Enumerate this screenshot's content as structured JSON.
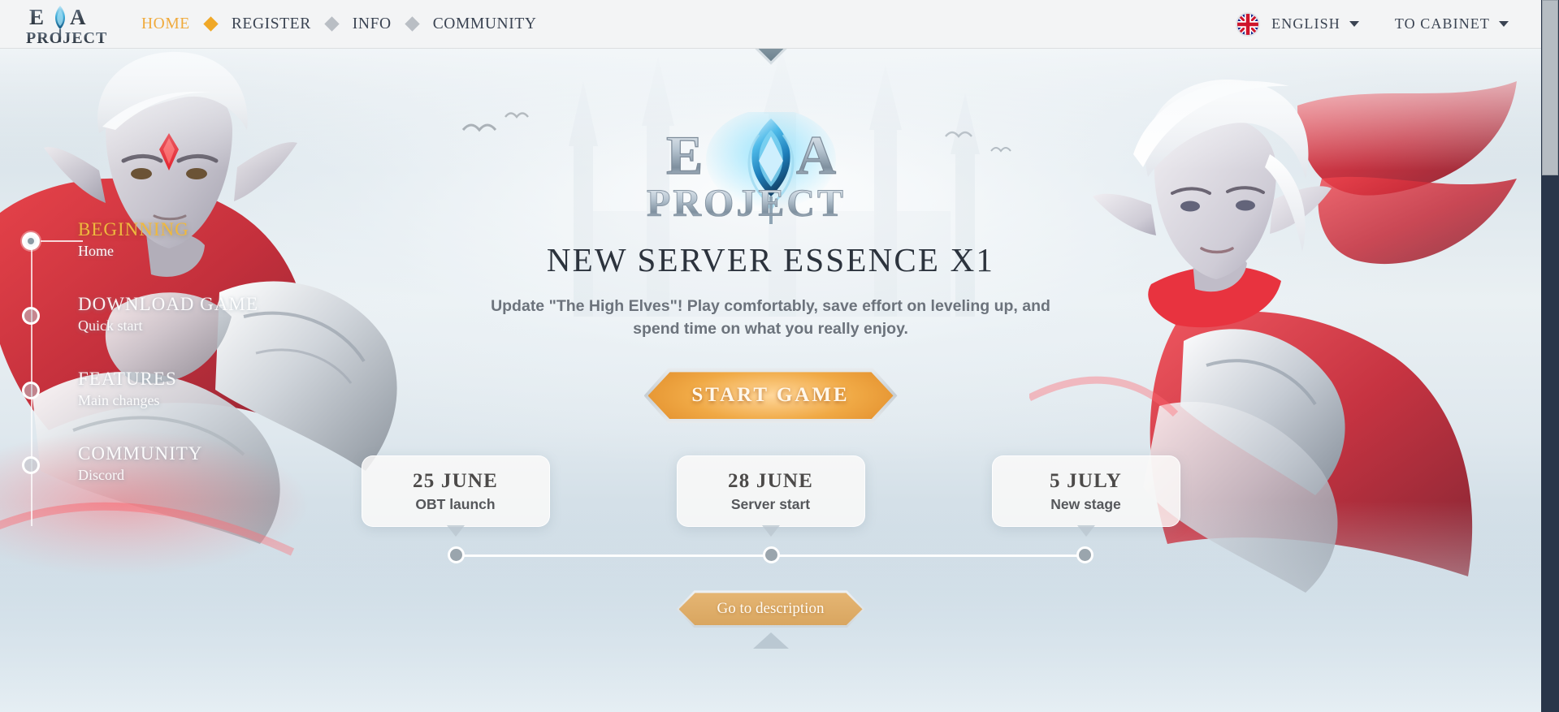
{
  "header": {
    "logo_text_top": "EVA",
    "logo_text_bottom": "PROJECT",
    "logo_icon": "eva-crystal-logo",
    "nav": [
      {
        "label": "HOME",
        "active": true
      },
      {
        "label": "REGISTER",
        "active": false
      },
      {
        "label": "INFO",
        "active": false
      },
      {
        "label": "COMMUNITY",
        "active": false
      }
    ],
    "language": {
      "flag_icon": "uk-flag-icon",
      "label": "ENGLISH",
      "chevron_icon": "chevron-down-icon"
    },
    "cabinet": {
      "label": "TO CABINET",
      "chevron_icon": "chevron-down-icon"
    }
  },
  "sidebar": {
    "items": [
      {
        "title": "BEGINNING",
        "sub": "Home",
        "active": true
      },
      {
        "title": "DOWNLOAD GAME",
        "sub": "Quick start",
        "active": false
      },
      {
        "title": "FEATURES",
        "sub": "Main changes",
        "active": false
      },
      {
        "title": "COMMUNITY",
        "sub": "Discord",
        "active": false
      }
    ]
  },
  "hero": {
    "logo_title_top": "EVA",
    "logo_title_bottom": "PROJECT",
    "title": "NEW SERVER ESSENCE X1",
    "subtitle": "Update \"The High Elves\"! Play comfortably, save effort on leveling up, and spend time on what you really enjoy.",
    "start_button": "START GAME",
    "goto_button": "Go to description",
    "top_diamond_icon": "diamond-marker-icon",
    "bottom_chevron_icon": "chevron-down-large-icon"
  },
  "timeline": {
    "cards": [
      {
        "date": "25 JUNE",
        "label": "OBT launch"
      },
      {
        "date": "28 JUNE",
        "label": "Server start"
      },
      {
        "date": "5 JULY",
        "label": "New stage"
      }
    ]
  },
  "colors": {
    "accent_gold": "#f0aa3c",
    "button_orange": "#f0a945",
    "button_tan": "#e5b573",
    "header_bg": "#f3f4f5",
    "text_dark": "#3a4352",
    "scrollbar_thumb": "#b6bdc3",
    "scrollbar_track": "#29364a"
  },
  "scrollbar": {
    "thumb_name": "vertical-scrollbar-thumb",
    "track_name": "vertical-scrollbar-track"
  }
}
